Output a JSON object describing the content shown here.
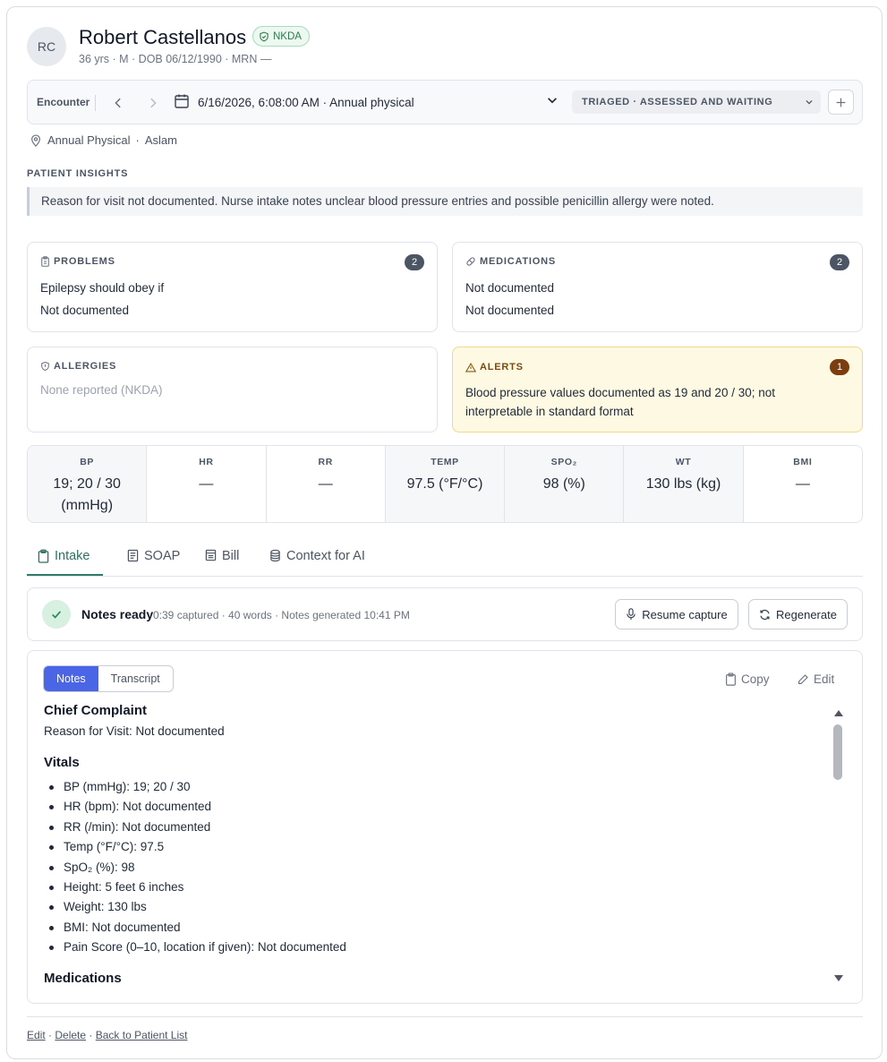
{
  "patient": {
    "initials": "RC",
    "name": "Robert Castellanos",
    "allergy_badge": "NKDA",
    "meta": "36 yrs · M · DOB 06/12/1990 · MRN —"
  },
  "encounter": {
    "label": "Encounter",
    "datetime_text": "6/16/2026, 6:08:00 AM · Annual physical",
    "status": "TRIAGED · ASSESSED AND WAITING"
  },
  "location": {
    "text": "Annual Physical",
    "provider": "Aslam"
  },
  "insights": {
    "title": "PATIENT INSIGHTS",
    "text": "Reason for visit not documented. Nurse intake notes unclear blood pressure entries and possible penicillin allergy were noted."
  },
  "cards": {
    "problems": {
      "title": "PROBLEMS",
      "count": "2",
      "items": [
        "Epilepsy should obey if",
        "Not documented"
      ]
    },
    "medications": {
      "title": "MEDICATIONS",
      "count": "2",
      "items": [
        "Not documented",
        "Not documented"
      ]
    },
    "allergies": {
      "title": "ALLERGIES",
      "text": "None reported (NKDA)"
    },
    "alerts": {
      "title": "ALERTS",
      "count": "1",
      "text": "Blood pressure values documented as 19 and 20 / 30; not interpretable in standard format"
    }
  },
  "vitals": [
    {
      "label": "BP",
      "value": "19; 20 / 30 (mmHg)"
    },
    {
      "label": "HR",
      "value": "—"
    },
    {
      "label": "RR",
      "value": "—"
    },
    {
      "label": "TEMP",
      "value": "97.5 (°F/°C)"
    },
    {
      "label": "SPO₂",
      "value": "98 (%)"
    },
    {
      "label": "WT",
      "value": "130 lbs (kg)"
    },
    {
      "label": "BMI",
      "value": "—"
    }
  ],
  "tabs": [
    "Intake",
    "SOAP",
    "Bill",
    "Context for AI"
  ],
  "ready": {
    "title": "Notes ready",
    "meta": "0:39 captured · 40 words · Notes generated 10:41 PM",
    "resume_label": "Resume capture",
    "regenerate_label": "Regenerate"
  },
  "notes": {
    "seg_notes": "Notes",
    "seg_transcript": "Transcript",
    "copy_label": "Copy",
    "edit_label": "Edit",
    "chief_complaint_heading": "Chief Complaint",
    "chief_complaint_text": "Reason for Visit: Not documented",
    "vitals_heading": "Vitals",
    "vitals_items": [
      "BP (mmHg): 19; 20 / 30",
      "HR (bpm): Not documented",
      "RR (/min): Not documented",
      "Temp (°F/°C): 97.5",
      "SpO₂ (%): 98",
      "Height: 5 feet 6 inches",
      "Weight: 130 lbs",
      "BMI: Not documented",
      "Pain Score (0–10, location if given): Not documented"
    ],
    "medications_heading": "Medications"
  },
  "footer": {
    "edit": "Edit",
    "delete": "Delete",
    "back": "Back to Patient List"
  }
}
